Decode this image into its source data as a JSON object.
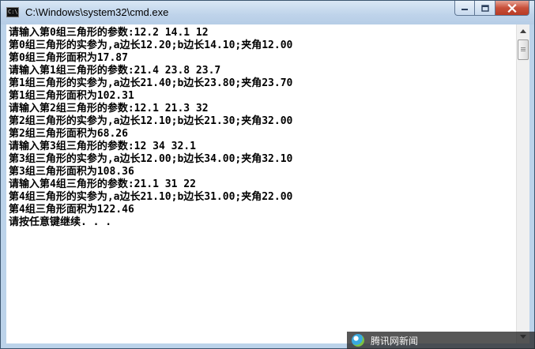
{
  "window": {
    "title": "C:\\Windows\\system32\\cmd.exe",
    "icon": "cmd-icon",
    "icon_glyph": "C:\\",
    "buttons": {
      "minimize": "minimize-icon",
      "maximize": "maximize-icon",
      "close": "close-icon"
    }
  },
  "console": {
    "background": "#ffffff",
    "text_color": "#000000",
    "lines": [
      "请输入第0组三角形的参数:12.2 14.1 12",
      "第0组三角形的实参为,a边长12.20;b边长14.10;夹角12.00",
      "第0组三角形面积为17.87",
      "请输入第1组三角形的参数:21.4 23.8 23.7",
      "第1组三角形的实参为,a边长21.40;b边长23.80;夹角23.70",
      "第1组三角形面积为102.31",
      "请输入第2组三角形的参数:12.1 21.3 32",
      "第2组三角形的实参为,a边长12.10;b边长21.30;夹角32.00",
      "第2组三角形面积为68.26",
      "请输入第3组三角形的参数:12 34 32.1",
      "第3组三角形的实参为,a边长12.00;b边长34.00;夹角32.10",
      "第3组三角形面积为108.36",
      "请输入第4组三角形的参数:21.1 31 22",
      "第4组三角形的实参为,a边长21.10;b边长31.00;夹角22.00",
      "第4组三角形面积为122.46",
      "请按任意键继续. . ."
    ]
  },
  "scrollbar": {
    "up_icon": "scroll-up-arrow-icon",
    "down_icon": "scroll-down-arrow-icon"
  },
  "watermark": {
    "text": "腾讯网新闻"
  },
  "colors": {
    "titlebar": "#bed3ea",
    "close_button": "#c8503a"
  }
}
